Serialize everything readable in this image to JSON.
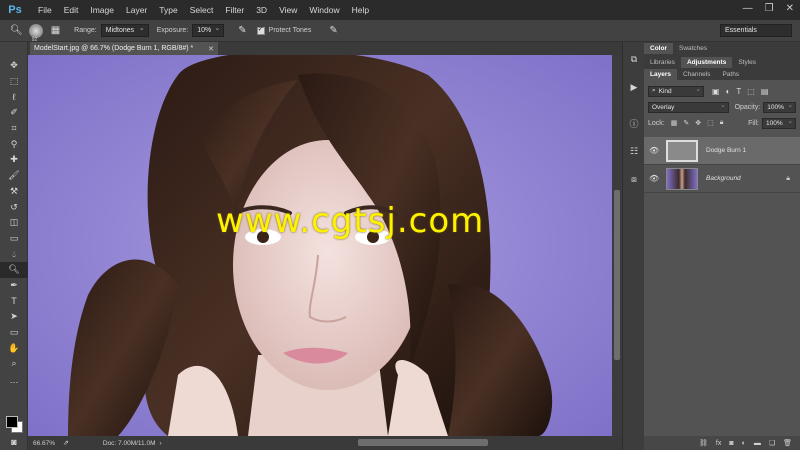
{
  "app": {
    "logo": "Ps",
    "menu": [
      "File",
      "Edit",
      "Image",
      "Layer",
      "Type",
      "Select",
      "Filter",
      "3D",
      "View",
      "Window",
      "Help"
    ],
    "window_controls": [
      "—",
      "❐",
      "✕"
    ]
  },
  "options": {
    "brush_size": "92",
    "range_label": "Range:",
    "range_value": "Midtones",
    "exposure_label": "Exposure:",
    "exposure_value": "10%",
    "protect_tones_label": "Protect Tones",
    "workspace": "Essentials"
  },
  "document": {
    "tab_title": "ModelStart.jpg @ 66.7% (Dodge Burn 1, RGB/8#) *",
    "watermark": "www.cgtsj.com",
    "zoom": "66.67%",
    "doc_size": "Doc: 7.00M/11.0M"
  },
  "panels": {
    "top_tabs": [
      "Color",
      "Swatches"
    ],
    "mid_tabs": [
      "Libraries",
      "Adjustments",
      "Styles"
    ],
    "layer_tabs": [
      "Layers",
      "Channels",
      "Paths"
    ],
    "kind_filter": "Kind",
    "blend_mode": "Overlay",
    "opacity_label": "Opacity:",
    "opacity_value": "100%",
    "lock_label": "Lock:",
    "fill_label": "Fill:",
    "fill_value": "100%",
    "layers": [
      {
        "name": "Dodge Burn 1",
        "selected": true
      },
      {
        "name": "Background",
        "selected": false
      }
    ]
  },
  "colors": {
    "accent": "#5bb7f0",
    "canvas_bg": "#8e7fd0",
    "watermark": "#fff200"
  }
}
